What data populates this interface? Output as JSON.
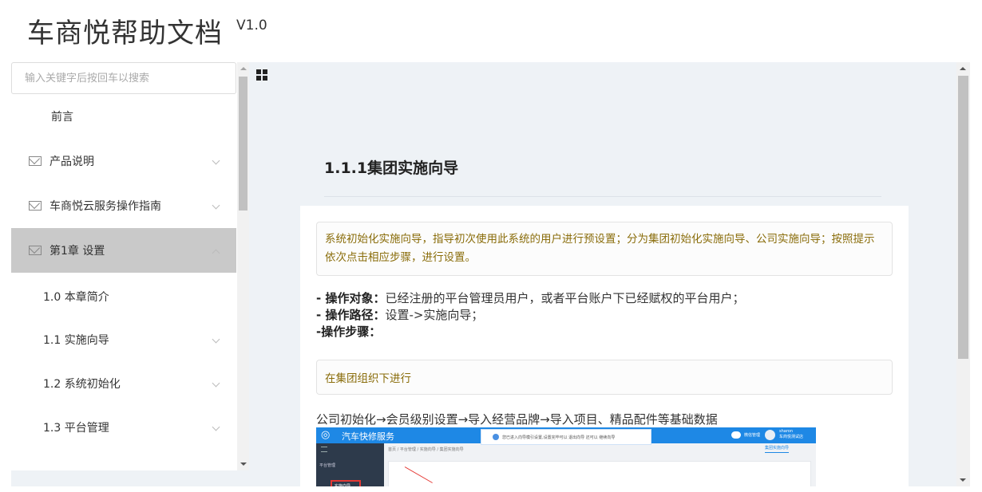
{
  "header": {
    "title": "车商悦帮助文档",
    "version": "V1.0"
  },
  "search": {
    "placeholder": "输入关键字后按回车以搜索"
  },
  "sidebar": {
    "items": [
      {
        "label": "前言"
      },
      {
        "label": "产品说明",
        "icon": "mail-icon"
      },
      {
        "label": "车商悦云服务操作指南",
        "icon": "mail-icon"
      },
      {
        "label": "第1章 设置",
        "icon": "mail-icon"
      },
      {
        "label": "1.0 本章简介"
      },
      {
        "label": "1.1 实施向导"
      },
      {
        "label": "1.2 系统初始化"
      },
      {
        "label": "1.3 平台管理"
      }
    ]
  },
  "main": {
    "doc_title": "1.1.1集团实施向导",
    "tip_text": "系统初始化实施向导，指导初次使用此系统的用户进行预设置；分为集团初始化实施向导、公司实施向导；按照提示依次点击相应步骤，进行设置。",
    "op_target_label": "- 操作对象：",
    "op_target_value": "已经注册的平台管理员用户，或者平台账户下已经赋权的平台用户；",
    "op_path_label": "- 操作路径：",
    "op_path_value": "设置->实施向导；",
    "op_steps_label": "-操作步骤：",
    "tip2_text": "在集团组织下进行",
    "flow_text": "公司初始化→会员级别设置→导入经营品牌→导入项目、精品配件等基础数据",
    "screenshot": {
      "app_name": "汽车快修服务",
      "notice": "您已进入向导模引设置,设置完毕可以 退出向导 还可以 继续向导",
      "manager": "微信管理",
      "user_name": "sharon",
      "user_shop": "车商悦测试店",
      "menu_item": "平台管理",
      "highlight_item": "实施向导",
      "breadcrumbs": "首页 / 平台管理 / 实施向导 / 集团实施向导",
      "tab_label": "集团实施向导"
    }
  },
  "colors": {
    "tip_text": "#8a6d0b",
    "active_bg": "#c9c9c9",
    "content_bg": "#eef2f6",
    "app_bar": "#1e88e5"
  }
}
